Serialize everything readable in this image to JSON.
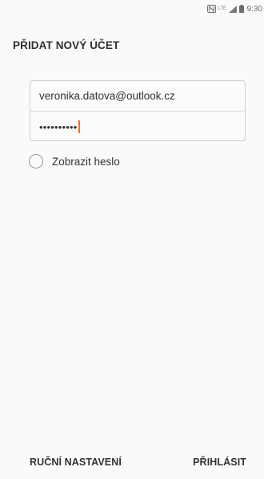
{
  "status_bar": {
    "network_label": "LTE",
    "time": "9:30"
  },
  "header": {
    "title": "PŘIDAT NOVÝ ÚČET"
  },
  "form": {
    "email_value": "veronika.datova@outlook.cz",
    "password_masked": "••••••••••",
    "show_password_label": "Zobrazit heslo",
    "show_password_checked": false
  },
  "actions": {
    "manual_setup_label": "RUČNÍ NASTAVENÍ",
    "login_label": "PŘIHLÁSIT"
  },
  "colors": {
    "cursor": "#e8702e",
    "background": "#fafafa",
    "border": "#cfcfcf"
  },
  "icons": [
    "nfc-icon",
    "signal-icon",
    "battery-icon"
  ]
}
